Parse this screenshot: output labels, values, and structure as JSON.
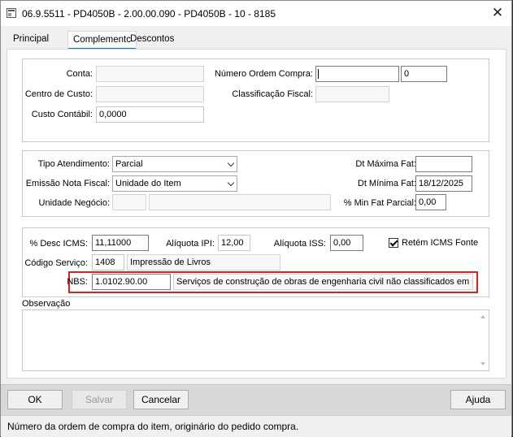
{
  "window": {
    "title": "06.9.5511 - PD4050B - 2.00.00.090 - PD4050B - 10 - 8185",
    "close_glyph": "✕"
  },
  "tabs": [
    {
      "label": "Principal"
    },
    {
      "label": "Complementc"
    },
    {
      "label": "Descontos"
    }
  ],
  "group1": {
    "conta_label": "Conta:",
    "conta_value": "",
    "centro_custo_label": "Centro de Custo:",
    "centro_custo_value": "",
    "custo_contabil_label": "Custo Contábil:",
    "custo_contabil_value": "0,0000",
    "numero_ordem_label": "Número Ordem Compra:",
    "numero_ordem_value": "",
    "numero_ordem_item": "0",
    "classificacao_fiscal_label": "Classificação Fiscal:",
    "classificacao_fiscal_value": ""
  },
  "group2": {
    "tipo_atendimento_label": "Tipo Atendimento:",
    "tipo_atendimento_value": "Parcial",
    "emissao_nota_label": "Emissão Nota Fiscal:",
    "emissao_nota_value": "Unidade do Item",
    "unidade_negocio_label": "Unidade Negócio:",
    "unidade_negocio_code": "",
    "unidade_negocio_desc": "",
    "dt_maxima_label": "Dt Máxima Fat:",
    "dt_maxima_value": "",
    "dt_minima_label": "Dt Mínima Fat:",
    "dt_minima_value": "18/12/2025",
    "min_fat_label": "% Min Fat Parcial:",
    "min_fat_value": "0,00"
  },
  "group3": {
    "desc_icms_label": "% Desc ICMS:",
    "desc_icms_value": "11,11000",
    "aliquota_ipi_label": "Alíquota IPI:",
    "aliquota_ipi_value": "12,00",
    "aliquota_iss_label": "Alíquota ISS:",
    "aliquota_iss_value": "0,00",
    "retem_icms_label": "Retém ICMS Fonte",
    "retem_icms_checked": true,
    "codigo_servico_label": "Código Serviço:",
    "codigo_servico_value": "1408",
    "codigo_servico_desc": "Impressão de Livros",
    "nbs_label": "NBS:",
    "nbs_value": "1.0102.90.00",
    "nbs_desc": "Serviços de construção de obras de engenharia civil não classificados em sub"
  },
  "observacao": {
    "label": "Observação",
    "value": ""
  },
  "buttons": {
    "ok": "OK",
    "salvar": "Salvar",
    "cancelar": "Cancelar",
    "ajuda": "Ajuda"
  },
  "status": {
    "text": "Número da ordem de compra do item, originário do pedido compra."
  },
  "colors": {
    "accent": "#0078d7",
    "highlight": "#e02020"
  }
}
